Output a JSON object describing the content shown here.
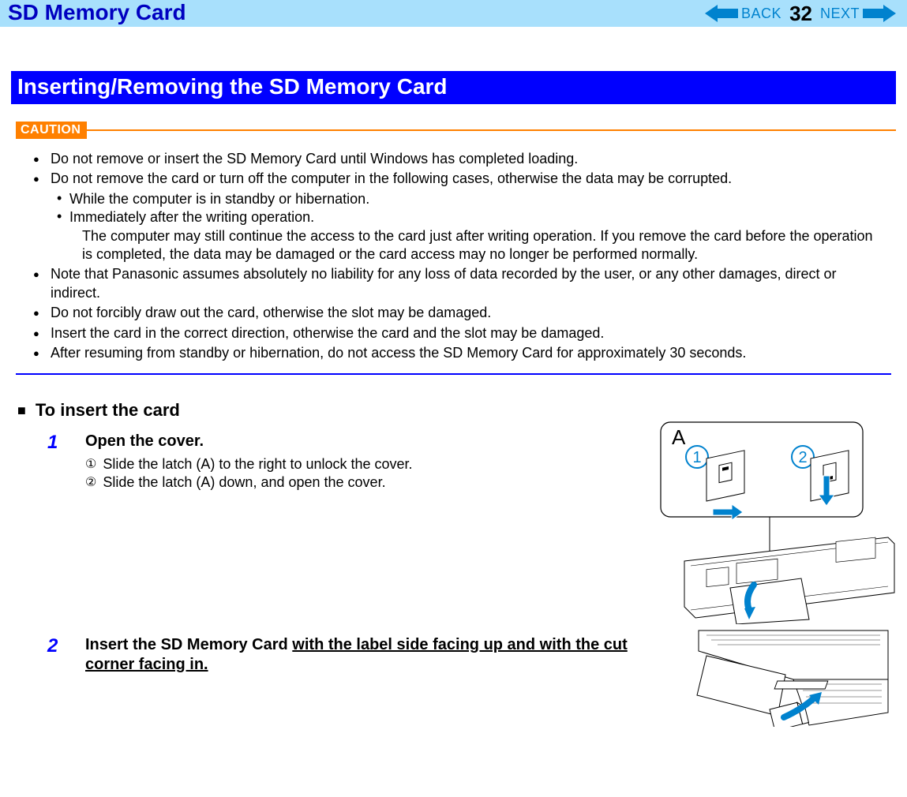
{
  "header": {
    "title": "SD Memory Card",
    "back_label": "BACK",
    "next_label": "NEXT",
    "page_number": "32"
  },
  "section": {
    "title": "Inserting/Removing the SD Memory Card"
  },
  "caution": {
    "label": "CAUTION",
    "items": [
      "Do not remove or insert the SD Memory Card until Windows has completed loading.",
      "Do not remove the card or turn off the computer in the following cases, otherwise the data may be corrupted.",
      "Note that Panasonic assumes absolutely no liability for any loss of data recorded by the user, or any other damages, direct or indirect.",
      "Do not forcibly draw out the card, otherwise the slot may be damaged.",
      "Insert the card in the correct direction, otherwise the card and the slot may be damaged.",
      "After resuming from standby or hibernation, do not access the SD Memory Card for approximately 30 seconds."
    ],
    "sub_items": {
      "a": "While the computer is in standby or hibernation.",
      "b": "Immediately after the writing operation.",
      "b_continue": "The computer may still continue the access to the card just after writing operation. If you remove the card before the operation is completed, the data may be damaged or the card access may no longer be performed normally."
    }
  },
  "insert": {
    "heading": "To insert the card",
    "step1": {
      "num": "1",
      "title": "Open the cover.",
      "a_mark": "①",
      "a": "Slide the latch (A) to the right to unlock the cover.",
      "b_mark": "②",
      "b": "Slide the latch (A) down, and open the cover."
    },
    "step2": {
      "num": "2",
      "title_prefix": "Insert the SD Memory Card ",
      "title_underline": "with the label side facing up and with the cut corner facing in."
    }
  },
  "illus1": {
    "label_a": "A",
    "circ1": "1",
    "circ2": "2"
  }
}
